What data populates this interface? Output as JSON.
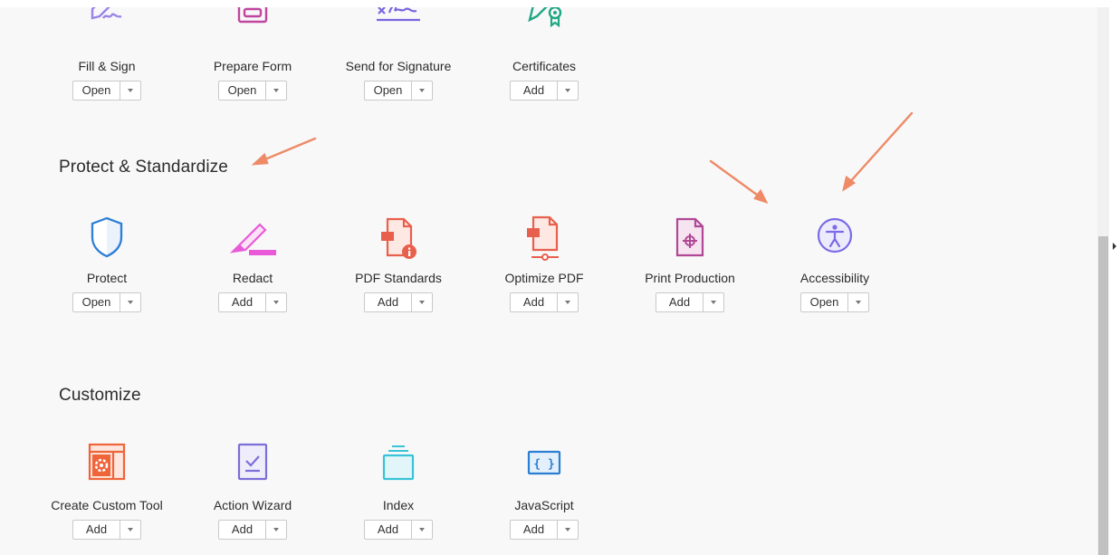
{
  "sections": {
    "top": {
      "tools": [
        {
          "name": "Fill & Sign",
          "action": "Open",
          "icon": "fill-sign-icon",
          "color": "#9a84e8"
        },
        {
          "name": "Prepare Form",
          "action": "Open",
          "icon": "prepare-form-icon",
          "color": "#c0459f"
        },
        {
          "name": "Send for Signature",
          "action": "Open",
          "icon": "send-signature-icon",
          "color": "#7966e0"
        },
        {
          "name": "Certificates",
          "action": "Add",
          "icon": "certificates-icon",
          "color": "#1ea784"
        }
      ]
    },
    "protect": {
      "title": "Protect & Standardize",
      "tools": [
        {
          "name": "Protect",
          "action": "Open",
          "icon": "shield-icon",
          "color": "#2e7fd6"
        },
        {
          "name": "Redact",
          "action": "Add",
          "icon": "redact-icon",
          "color": "#e85ad7"
        },
        {
          "name": "PDF Standards",
          "action": "Add",
          "icon": "pdf-standards-icon",
          "color": "#e8604d"
        },
        {
          "name": "Optimize PDF",
          "action": "Add",
          "icon": "optimize-pdf-icon",
          "color": "#e8604d"
        },
        {
          "name": "Print Production",
          "action": "Add",
          "icon": "print-production-icon",
          "color": "#b04895"
        },
        {
          "name": "Accessibility",
          "action": "Open",
          "icon": "accessibility-icon",
          "color": "#7a6be6"
        }
      ]
    },
    "customize": {
      "title": "Customize",
      "tools": [
        {
          "name": "Create Custom Tool",
          "action": "Add",
          "icon": "custom-tool-icon",
          "color": "#f0643a"
        },
        {
          "name": "Action Wizard",
          "action": "Add",
          "icon": "action-wizard-icon",
          "color": "#7b6fd8"
        },
        {
          "name": "Index",
          "action": "Add",
          "icon": "index-icon",
          "color": "#38c3d8"
        },
        {
          "name": "JavaScript",
          "action": "Add",
          "icon": "javascript-icon",
          "color": "#2a7fd4"
        }
      ]
    }
  },
  "annotation_color": "#ee8a66"
}
